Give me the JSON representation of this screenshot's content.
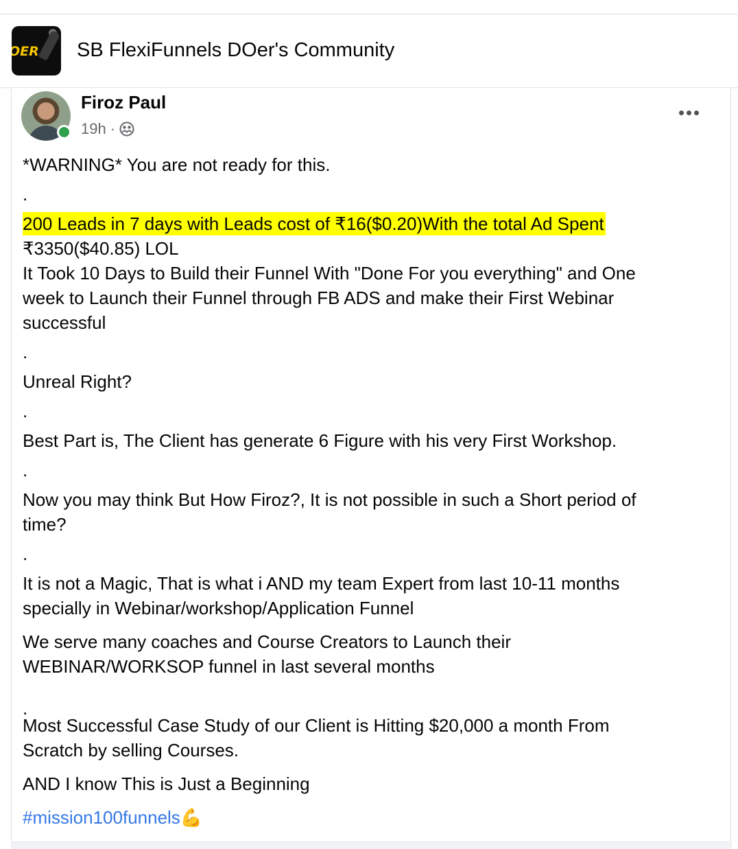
{
  "group": {
    "name": "SB FlexiFunnels DOer's Community",
    "logo_text": "OER"
  },
  "post": {
    "author": "Firoz Paul",
    "time": "19h",
    "separator": "·",
    "privacy_icon": "group-audience-icon",
    "lines": {
      "l1": "*WARNING* You are not ready for this.",
      "d1": ".",
      "hl": "200 Leads in 7 days with Leads cost of ₹16($0.20)With the total Ad Spent",
      "l2": "₹3350($40.85) LOL",
      "l3": "It Took 10 Days to Build their Funnel With \"Done For you everything\" and One",
      "l4": "week to Launch their Funnel through FB ADS and make their First Webinar",
      "l5": "successful",
      "d2": ".",
      "l6": "Unreal Right?",
      "d3": ".",
      "l7": "Best Part is, The Client has generate 6 Figure with his very First Workshop.",
      "d4": ".",
      "l8": "Now you may think But How Firoz?, It is not possible in such a Short period of",
      "l9": "time?",
      "d5": ".",
      "l10": "It is not a Magic, That is what i AND my team Expert from last 10-11 months",
      "l11": "specially in Webinar/workshop/Application Funnel",
      "l12": "We serve many coaches and Course Creators to Launch their",
      "l13": "WEBINAR/WORKSOP funnel in last several months",
      "d6": ".",
      "l14": "Most Successful Case Study of our Client is Hitting $20,000 a month From",
      "l15": "Scratch by selling Courses.",
      "l16": "AND I know This is Just a Beginning",
      "hashtag": "#mission100funnels",
      "emoji": "💪"
    }
  },
  "colors": {
    "highlight": "#ffff00",
    "hashtag": "#3578e5",
    "meta_text": "#65676b",
    "online": "#31a24c"
  }
}
